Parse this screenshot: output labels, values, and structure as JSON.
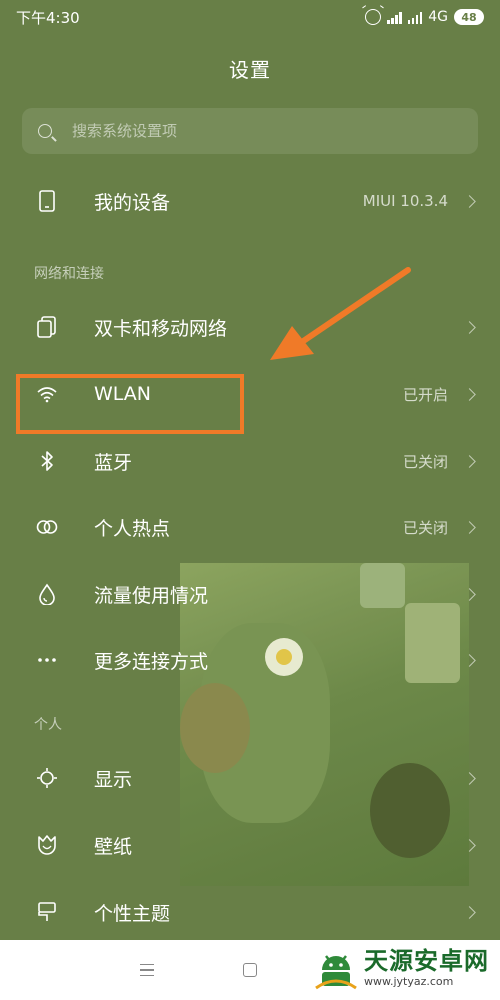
{
  "status_bar": {
    "time": "下午4:30",
    "network": "4G",
    "battery": "48"
  },
  "header": {
    "title": "设置"
  },
  "search": {
    "placeholder": "搜索系统设置项"
  },
  "device_row": {
    "label": "我的设备",
    "value": "MIUI 10.3.4"
  },
  "sections": {
    "network": {
      "title": "网络和连接",
      "items": [
        {
          "label": "双卡和移动网络",
          "value": ""
        },
        {
          "label": "WLAN",
          "value": "已开启"
        },
        {
          "label": "蓝牙",
          "value": "已关闭"
        },
        {
          "label": "个人热点",
          "value": "已关闭"
        },
        {
          "label": "流量使用情况",
          "value": ""
        },
        {
          "label": "更多连接方式",
          "value": ""
        }
      ]
    },
    "personal": {
      "title": "个人",
      "items": [
        {
          "label": "显示",
          "value": ""
        },
        {
          "label": "壁纸",
          "value": ""
        },
        {
          "label": "个性主题",
          "value": ""
        }
      ]
    }
  },
  "annotation": {
    "color": "#f07a28"
  },
  "watermark": {
    "name": "天源安卓网",
    "url": "www.jytyaz.com"
  },
  "colors": {
    "background": "#687f47",
    "accent": "#f07a28"
  }
}
